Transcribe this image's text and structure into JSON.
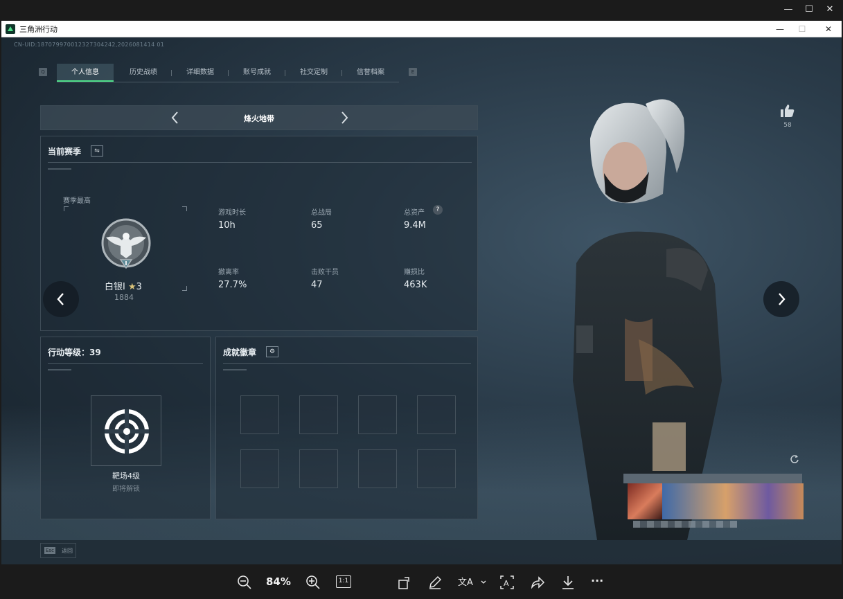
{
  "viewer": {
    "window_controls": {
      "minimize": "—",
      "maximize": "☐",
      "close": "✕"
    },
    "zoom_label": "84%",
    "actual_size_label": "1:1",
    "more_label": "···"
  },
  "app": {
    "title": "三角洲行动",
    "uid": "CN-UID:18707997001232730424​2,2026081414 01",
    "tabs": {
      "key_left": "Q",
      "key_right": "E",
      "items": [
        "个人信息",
        "历史战绩",
        "详细数据",
        "账号成就",
        "社交定制",
        "信誉档案"
      ]
    },
    "mode": {
      "title": "烽火地带"
    },
    "season": {
      "title": "当前赛季",
      "swap_icon": "⇋",
      "best_label": "赛季最高",
      "rank_name": "白银I",
      "rank_star": "★",
      "rank_stars": "3",
      "rank_score": "1884",
      "stats": [
        {
          "label": "游戏时长",
          "value": "10h"
        },
        {
          "label": "总战局",
          "value": "65"
        },
        {
          "label": "总资产",
          "value": "9.4M",
          "help": "?"
        },
        {
          "label": "撤离率",
          "value": "27.7%"
        },
        {
          "label": "击败干员",
          "value": "47"
        },
        {
          "label": "赚损比",
          "value": "463K"
        }
      ]
    },
    "action_level": {
      "title": "行动等级：39",
      "item_name": "靶场4级",
      "item_status": "即将解锁"
    },
    "badges": {
      "title": "成就徽章",
      "gear_icon": "⚙"
    },
    "likes": {
      "count": "58"
    },
    "esc": {
      "key": "Esc",
      "label": "返回"
    }
  }
}
